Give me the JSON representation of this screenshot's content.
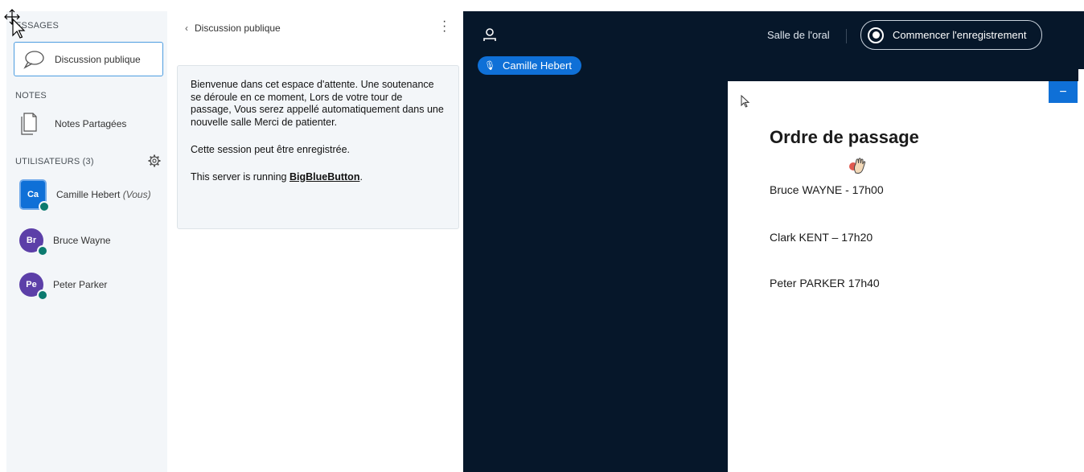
{
  "sidebar": {
    "messages_title": "ESSAGES",
    "chat_item": "Discussion publique",
    "notes_title": "NOTES",
    "notes_item": "Notes Partagées",
    "users_title": "UTILISATEURS (3)",
    "users": [
      {
        "initials": "Ca",
        "name": "Camille Hebert",
        "suffix": "(Vous)"
      },
      {
        "initials": "Br",
        "name": "Bruce Wayne",
        "suffix": ""
      },
      {
        "initials": "Pe",
        "name": "Peter Parker",
        "suffix": ""
      }
    ]
  },
  "chat": {
    "header": "Discussion publique",
    "welcome": "Bienvenue dans cet espace d'attente. Une soutenance se déroule en ce moment, Lors de votre tour de passage, Vous serez appellé automatiquement dans une nouvelle salle Merci de patienter.",
    "recorded": "Cette session peut être enregistrée.",
    "server_prefix": "This server is running ",
    "server_link": "BigBlueButton",
    "server_suffix": "."
  },
  "stage": {
    "room_name": "Salle de l'oral",
    "record_label": "Commencer l'enregistrement",
    "talker": "Camille Hebert",
    "minimize_label": "−"
  },
  "slide": {
    "title": "Ordre de passage",
    "lines": [
      "Bruce WAYNE -  17h00",
      "Clark KENT – 17h20",
      "Peter PARKER 17h40"
    ]
  },
  "colors": {
    "accent": "#0f70d7",
    "stage_bg": "#06172a",
    "sidebar_bg": "#f3f6f9",
    "badge": "#0b7a6f",
    "avatar_purple": "#5c3fa8"
  }
}
